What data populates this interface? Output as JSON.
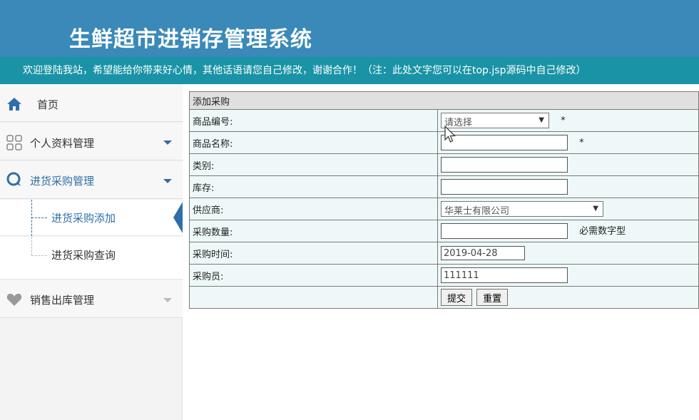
{
  "header": {
    "title": "生鲜超市进销存管理系统",
    "notice": "欢迎登陆我站，希望能给你带来好心情，其他话语请您自己修改，谢谢合作！（注：此处文字您可以在top.jsp源码中自己修改）"
  },
  "sidebar": {
    "home": "首页",
    "profile": "个人资料管理",
    "purchase": "进货采购管理",
    "purchase_add": "进货采购添加",
    "purchase_query": "进货采购查询",
    "sales": "销售出库管理"
  },
  "form": {
    "title": "添加采购",
    "fields": {
      "product_code": {
        "label": "商品编号:",
        "placeholder": "请选择"
      },
      "product_name": {
        "label": "商品名称:",
        "value": ""
      },
      "category": {
        "label": "类别:",
        "value": ""
      },
      "stock": {
        "label": "库存:",
        "value": ""
      },
      "supplier": {
        "label": "供应商:",
        "value": "华莱士有限公司"
      },
      "quantity": {
        "label": "采购数量:",
        "value": "",
        "hint": "必需数字型"
      },
      "purchase_time": {
        "label": "采购时间:",
        "value": "2019-04-28"
      },
      "buyer": {
        "label": "采购员:",
        "value": "111111"
      }
    },
    "required_mark": "*",
    "submit_label": "提交",
    "reset_label": "重置"
  },
  "colors": {
    "header_bg": "#3a89b8",
    "notice_bg": "#1a93a6",
    "accent": "#2e6fa8"
  }
}
